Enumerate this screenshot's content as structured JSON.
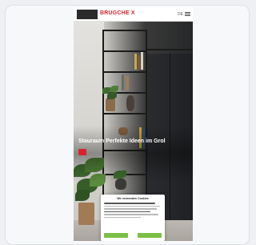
{
  "header": {
    "logo_text": "",
    "brand": "BRUGCHE X",
    "lang_label": "DE"
  },
  "hero": {
    "eyebrow": "",
    "title": "Stauraum Perfekte Ideen im Grol",
    "cta_label": ""
  },
  "cookie": {
    "title": "Wir verwenden Cookies",
    "accept_label": "",
    "settings_label": ""
  },
  "colors": {
    "brand_red": "#d7262b",
    "accept_green": "#7bbf47",
    "wardrobe": "#24272a"
  }
}
